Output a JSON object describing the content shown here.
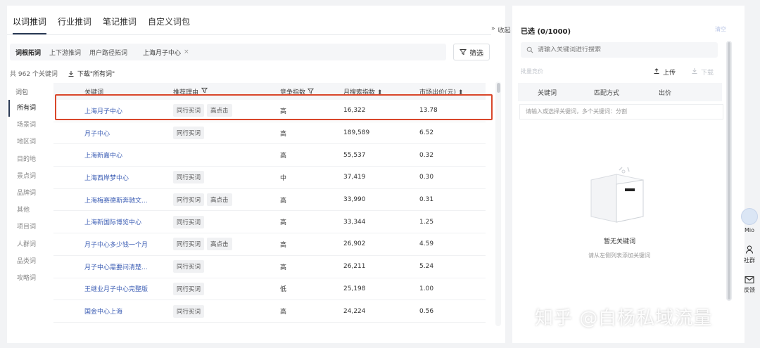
{
  "tabs": [
    "以词推词",
    "行业推词",
    "笔记推词",
    "自定义词包"
  ],
  "collapse_label": "收起",
  "filter": {
    "chips": [
      "词根拓词",
      "上下游推词",
      "用户路径拓词"
    ],
    "tag": "上海月子中心",
    "tag_close": "×",
    "filter_btn": "筛选"
  },
  "count_text": "共 962 个关键词",
  "download_label": "下载\"所有词\"",
  "categories": {
    "header": "词包",
    "items": [
      "所有词",
      "场景词",
      "地区词",
      "目的地",
      "景点词",
      "品牌词",
      "其他",
      "项目词",
      "人群词",
      "品类词",
      "攻略词"
    ],
    "active_index": 0
  },
  "table": {
    "headers": [
      "关键词",
      "推荐理由",
      "竞争指数",
      "月搜索指数",
      "市场出价(元)"
    ],
    "rows": [
      {
        "kw": "上海月子中心",
        "tags": [
          "同行买词",
          "高点击"
        ],
        "comp": "高",
        "search": "16,322",
        "price": "13.78"
      },
      {
        "kw": "月子中心",
        "tags": [
          "同行买词"
        ],
        "comp": "高",
        "search": "189,589",
        "price": "6.52"
      },
      {
        "kw": "上海新嘉中心",
        "tags": [],
        "comp": "高",
        "search": "55,537",
        "price": "0.32"
      },
      {
        "kw": "上海西岸梦中心",
        "tags": [
          "同行买词"
        ],
        "comp": "中",
        "search": "37,419",
        "price": "0.30"
      },
      {
        "kw": "上海梅赛德斯奔驰文...",
        "tags": [
          "同行买词",
          "高点击"
        ],
        "comp": "高",
        "search": "33,990",
        "price": "0.31"
      },
      {
        "kw": "上海新国际博览中心",
        "tags": [
          "同行买词"
        ],
        "comp": "高",
        "search": "33,344",
        "price": "1.25"
      },
      {
        "kw": "月子中心多少钱一个月",
        "tags": [
          "同行买词",
          "高点击"
        ],
        "comp": "高",
        "search": "26,902",
        "price": "4.59"
      },
      {
        "kw": "月子中心需要问清楚...",
        "tags": [
          "同行买词"
        ],
        "comp": "高",
        "search": "26,211",
        "price": "5.24"
      },
      {
        "kw": "王继业月子中心完整版",
        "tags": [
          "同行买词"
        ],
        "comp": "低",
        "search": "25,198",
        "price": "1.00"
      },
      {
        "kw": "国金中心上海",
        "tags": [
          "同行买词"
        ],
        "comp": "高",
        "search": "24,224",
        "price": "0.56"
      }
    ]
  },
  "right": {
    "title": "已选 (0/1000)",
    "clear": "清空",
    "search_placeholder": "请输入关键词进行搜索",
    "bulk_bid": "批量竞价",
    "upload": "上传",
    "download": "下载",
    "headers": [
      "关键词",
      "匹配方式",
      "出价"
    ],
    "input_hint": "请输入或选择关键词，多个关键词：分割",
    "empty_title": "暂无关键词",
    "empty_sub": "请从左侧列表添加关键词"
  },
  "side": {
    "mio": "Mio",
    "community": "社群",
    "feedback": "反馈"
  },
  "watermark": "知乎 @白杨私域流量"
}
